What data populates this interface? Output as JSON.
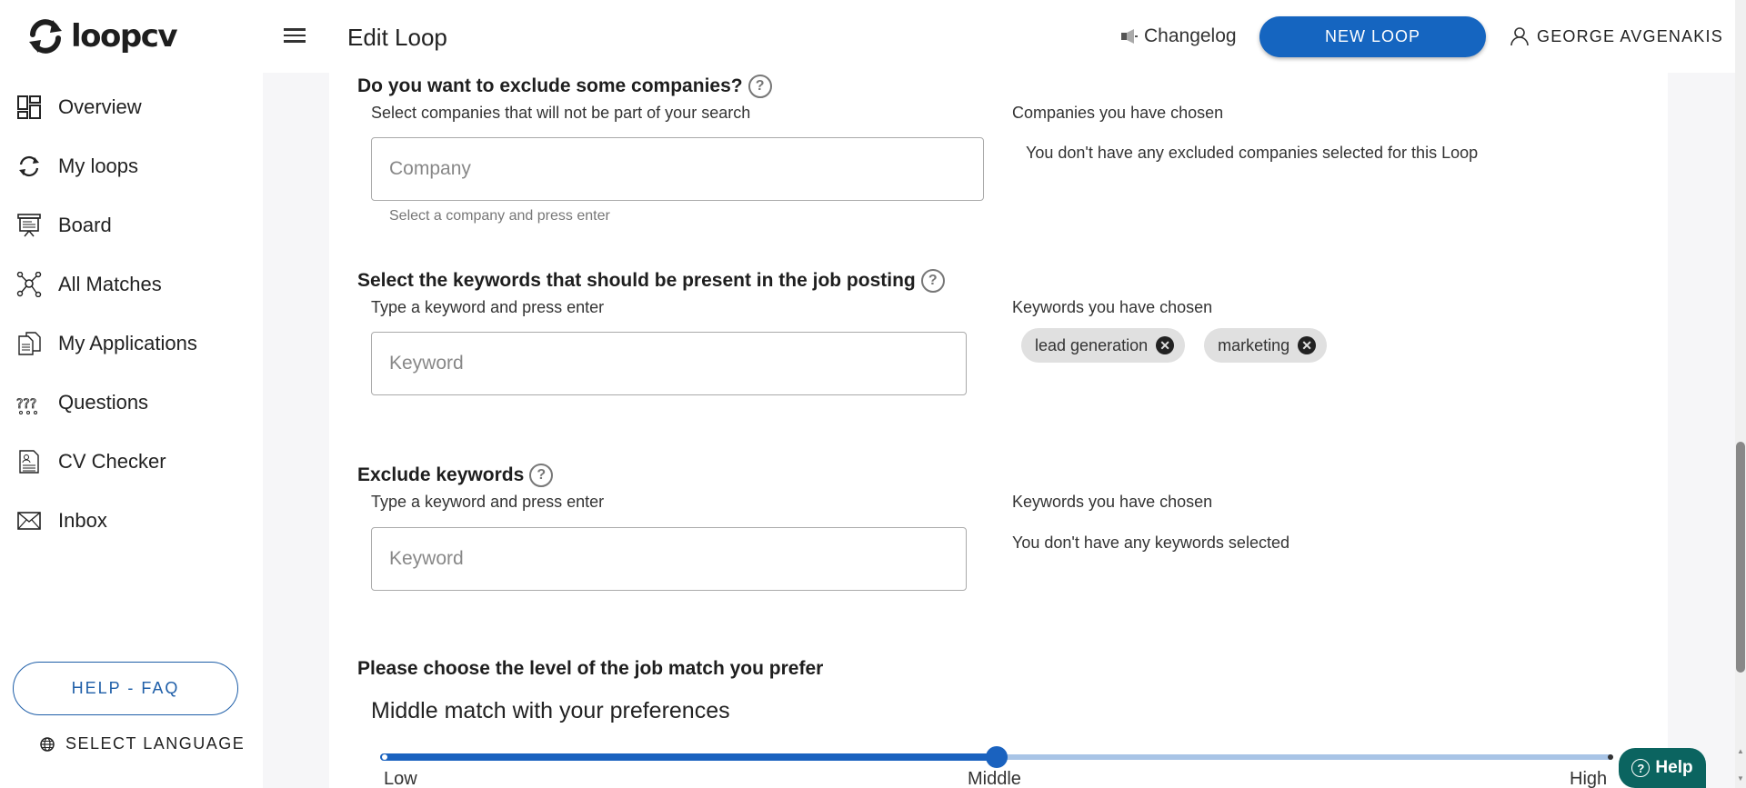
{
  "app": {
    "logo_text": "loopcv"
  },
  "header": {
    "title": "Edit Loop",
    "changelog_label": "Changelog",
    "new_loop_label": "NEW LOOP",
    "user_name": "GEORGE AVGENAKIS"
  },
  "sidebar": {
    "items": [
      {
        "label": "Overview",
        "icon": "dashboard-icon"
      },
      {
        "label": "My loops",
        "icon": "loop-icon"
      },
      {
        "label": "Board",
        "icon": "board-icon"
      },
      {
        "label": "All Matches",
        "icon": "network-icon"
      },
      {
        "label": "My Applications",
        "icon": "documents-icon"
      },
      {
        "label": "Questions",
        "icon": "questions-icon"
      },
      {
        "label": "CV Checker",
        "icon": "cv-icon"
      },
      {
        "label": "Inbox",
        "icon": "envelope-icon"
      }
    ],
    "help_faq_label": "HELP - FAQ",
    "select_language_label": "SELECT LANGUAGE"
  },
  "sections": {
    "exclude_companies": {
      "heading": "Do you want to exclude some companies?",
      "subtitle": "Select companies that will not be part of your search",
      "input_placeholder": "Company",
      "input_value": "",
      "helper": "Select a company and press enter",
      "chosen_label": "Companies you have chosen",
      "empty_text": "You don't have any excluded companies selected for this Loop"
    },
    "include_keywords": {
      "heading": "Select the keywords that should be present in the job posting",
      "subtitle": "Type a keyword and press enter",
      "input_placeholder": "Keyword",
      "input_value": "",
      "chosen_label": "Keywords you have chosen",
      "chips": [
        "lead generation",
        "marketing"
      ]
    },
    "exclude_keywords": {
      "heading": "Exclude keywords",
      "subtitle": "Type a keyword and press enter",
      "input_placeholder": "Keyword",
      "input_value": "",
      "chosen_label": "Keywords you have chosen",
      "empty_text": "You don't have any keywords selected"
    },
    "match_level": {
      "heading": "Please choose the level of the job match you prefer",
      "current_text": "Middle match with your preferences",
      "options": [
        "Low",
        "Middle",
        "High"
      ],
      "selected_index": 1,
      "value_fraction": 0.5
    }
  },
  "help_widget": {
    "label": "Help"
  },
  "colors": {
    "primary": "#1565c0",
    "help_widget": "#0b6460",
    "chip_bg": "#e0e0e0"
  }
}
